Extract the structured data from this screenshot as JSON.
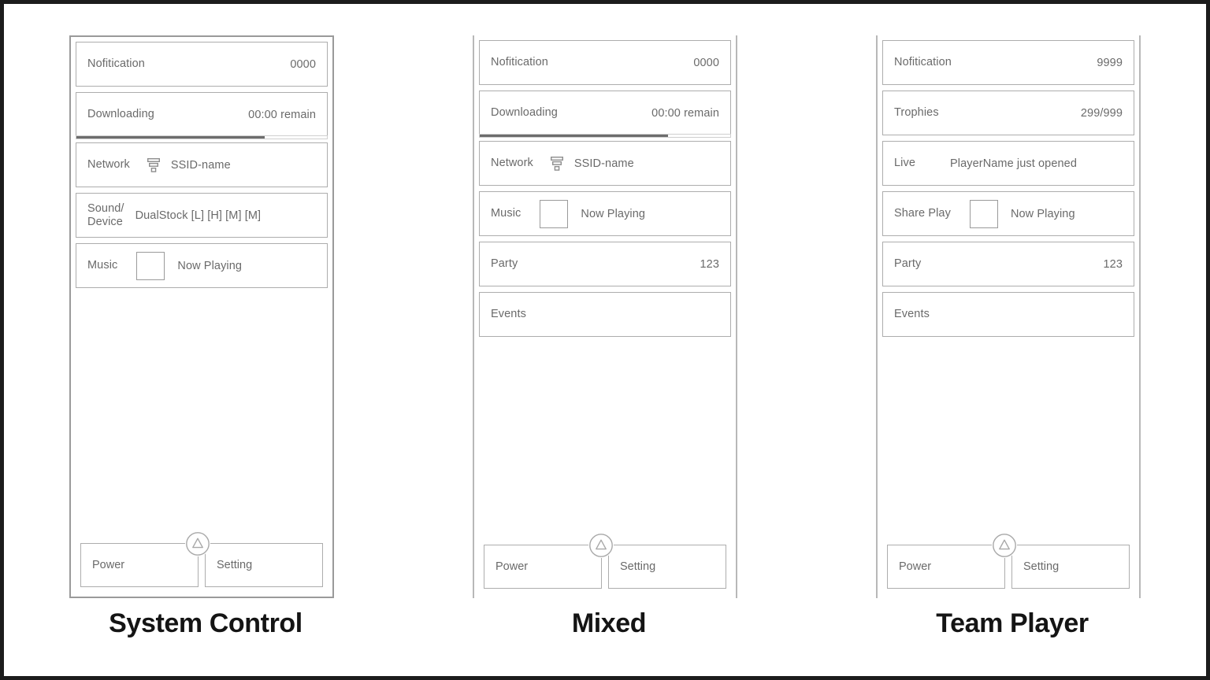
{
  "panels": [
    {
      "caption": "System Control",
      "frame_style": "framed",
      "rows": [
        {
          "label": "Nofitication",
          "value": "0000",
          "value_align": "right",
          "type": "text"
        },
        {
          "label": "Downloading",
          "value": "00:00 remain",
          "value_align": "right",
          "type": "progress",
          "progress_percent": 75
        },
        {
          "label": "Network",
          "value": "SSID-name",
          "value_align": "inline-sm",
          "type": "network"
        },
        {
          "label": "Sound/\nDevice",
          "value": "DualStock [L] [H] [M] [M]",
          "value_align": "inline-sm",
          "type": "text"
        },
        {
          "label": "Music",
          "value": "Now Playing",
          "value_align": "thumb",
          "type": "thumb"
        }
      ],
      "footer": {
        "power_label": "Power",
        "setting_label": "Setting",
        "badge_icon": "triangle-in-circle-icon"
      }
    },
    {
      "caption": "Mixed",
      "frame_style": "sided",
      "rows": [
        {
          "label": "Nofitication",
          "value": "0000",
          "value_align": "right",
          "type": "text"
        },
        {
          "label": "Downloading",
          "value": "00:00 remain",
          "value_align": "right",
          "type": "progress",
          "progress_percent": 75
        },
        {
          "label": "Network",
          "value": "SSID-name",
          "value_align": "inline-sm",
          "type": "network"
        },
        {
          "label": "Music",
          "value": "Now Playing",
          "value_align": "thumb",
          "type": "thumb"
        },
        {
          "label": "Party",
          "value": "123",
          "value_align": "right",
          "type": "text"
        },
        {
          "label": "Events",
          "value": "",
          "value_align": "right",
          "type": "text"
        }
      ],
      "footer": {
        "power_label": "Power",
        "setting_label": "Setting",
        "badge_icon": "triangle-in-circle-icon"
      }
    },
    {
      "caption": "Team Player",
      "frame_style": "sided",
      "rows": [
        {
          "label": "Nofitication",
          "value": "9999",
          "value_align": "right",
          "type": "text"
        },
        {
          "label": "Trophies",
          "value": "299/999",
          "value_align": "right",
          "type": "text"
        },
        {
          "label": "Live",
          "value": "PlayerName just opened",
          "value_align": "inline",
          "type": "text"
        },
        {
          "label": "Share Play",
          "value": "Now Playing",
          "value_align": "thumb",
          "type": "thumb"
        },
        {
          "label": "Party",
          "value": "123",
          "value_align": "right",
          "type": "text"
        },
        {
          "label": "Events",
          "value": "",
          "value_align": "right",
          "type": "text"
        }
      ],
      "footer": {
        "power_label": "Power",
        "setting_label": "Setting",
        "badge_icon": "triangle-in-circle-icon"
      }
    }
  ],
  "colors": {
    "page_border": "#1c1c1c",
    "panel_border_strong": "#9a9a9a",
    "panel_border_light": "#b8b8b8",
    "row_border": "#adadad",
    "text": "#6a6a6a",
    "caption_text": "#141414",
    "progress_fill": "#6d6d6d",
    "progress_track": "#cfcfcf"
  }
}
